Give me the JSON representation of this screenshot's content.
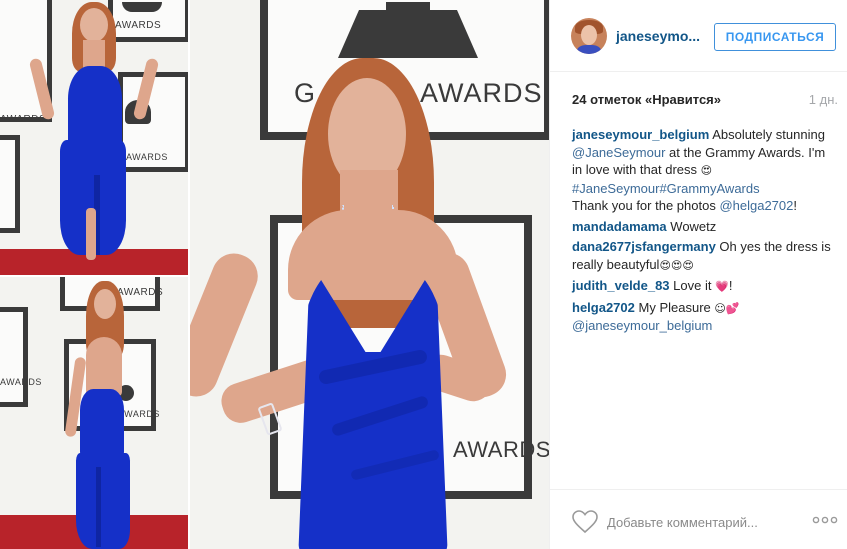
{
  "photo": {
    "logo_text": "AWARDS",
    "logo_text_big": "GRAMMY AWARDS",
    "logo_text_partial": "G",
    "logo_text_side": "AWARDS"
  },
  "header": {
    "username": "janeseymo...",
    "follow_label": "ПОДПИСАТЬСЯ"
  },
  "stats": {
    "likes": "24 отметок «Нравится»",
    "time_ago": "1 дн."
  },
  "comments": [
    {
      "user": "janeseymour_belgium",
      "parts": {
        "t1": "Absolutely stunning",
        "mention": "@JaneSeymour",
        "t2": "at the Grammy Awards. I'm in love with that dress",
        "emoji": "😍",
        "hashtags": "#JaneSeymour#GrammyAwards",
        "t3": "Thank you for the photos",
        "mention2": "@helga2702",
        "t4": "!"
      }
    },
    {
      "user": "mandadamama",
      "text": "Wowetz"
    },
    {
      "user": "dana2677jsfangermany",
      "text": "Oh yes the dress is really beautyful",
      "emoji": "😍😍😍"
    },
    {
      "user": "judith_velde_83",
      "text": "Love it",
      "emoji": "💗",
      "tail": "!"
    },
    {
      "user": "helga2702",
      "text": "My Pleasure",
      "emoji": "☺💕",
      "mention": "@janeseymour_belgium"
    }
  ],
  "footer": {
    "comment_placeholder": "Добавьте комментарий..."
  },
  "icons": {
    "heart": "heart-icon",
    "more": "more-options-icon"
  }
}
